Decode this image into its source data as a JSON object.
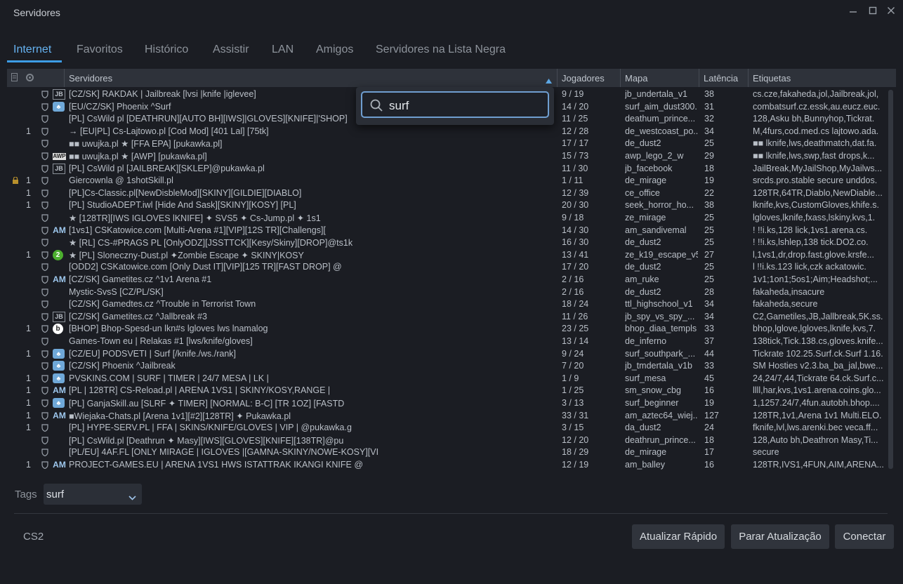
{
  "window": {
    "title": "Servidores"
  },
  "tabs": [
    "Internet",
    "Favoritos",
    "Histórico",
    "Assistir",
    "LAN",
    "Amigos",
    "Servidores na Lista Negra"
  ],
  "columns": {
    "servers": "Servidores",
    "players": "Jogadores",
    "map": "Mapa",
    "latency": "Latência",
    "tags": "Etiquetas"
  },
  "search": {
    "value": "surf"
  },
  "rows": [
    {
      "lock": false,
      "bots": "",
      "icon": "JB",
      "name": "[CZ/SK] RAKDAK | Jailbreak [lvsi |knife |iglevee]",
      "players": "9 / 19",
      "map": "jb_undertala_v1",
      "latency": "38",
      "tags": "cs.cze,fakaheda,jol,Jailbreak,jol,"
    },
    {
      "lock": false,
      "bots": "",
      "icon": "ph",
      "name": "[EU/CZ/SK] Phoenix ^Surf",
      "players": "14 / 20",
      "map": "surf_aim_dust300...",
      "latency": "31",
      "tags": "combatsurf.cz.essk,au.eucz.euc."
    },
    {
      "lock": false,
      "bots": "",
      "icon": "",
      "name": "[PL] CsWild pl [DEATHRUN][AUTO BH][IWS]|GLOVES][KNIFE]|'SHOP]",
      "players": "11 / 25",
      "map": "deathum_prince...",
      "latency": "32",
      "tags": "128,Asku bh,Bunnyhop,Tickrat."
    },
    {
      "lock": false,
      "bots": "1",
      "icon": "",
      "name": "→ [EU|PL] Cs-Lajtowo.pl [Cod Mod] [401 Lal] [75tk]",
      "players": "12 / 28",
      "map": "de_westcoast_po...",
      "latency": "34",
      "tags": "M,4furs,cod.med.cs lajtowo.ada."
    },
    {
      "lock": false,
      "bots": "",
      "icon": "",
      "name": "■■ uwujka.pl ★ [FFA EPA] [pukawka.pl]",
      "players": "17 / 17",
      "map": "de_dust2",
      "latency": "25",
      "tags": "■■ lknife,lws,deathmatch,dat.fa."
    },
    {
      "lock": false,
      "bots": "",
      "icon": "AW",
      "name": "■■ uwujka.pl ★ [AWP] [pukawka.pl]",
      "players": "15 / 73",
      "map": "awp_lego_2_w",
      "latency": "29",
      "tags": "■■ lknife,lws,swp,fast drops,k..."
    },
    {
      "lock": false,
      "bots": "",
      "icon": "JB",
      "name": "[PL] CsWild pl [JAILBREAK][SKLEP]@pukawka.pl",
      "players": "11 / 30",
      "map": "jb_facebook",
      "latency": "18",
      "tags": "JailBreak,MyJailShop,MyJailws..."
    },
    {
      "lock": true,
      "bots": "1",
      "icon": "",
      "name": "Giercownla @ 1shotSkill.pl",
      "players": "1 / 11",
      "map": "de_mirage",
      "latency": "19",
      "tags": "srcds.pro.stable secure unddos."
    },
    {
      "lock": false,
      "bots": "1",
      "icon": "",
      "name": "[PL]Cs-Classic.pl[NewDisbleMod][SKINY][GILDIE][DIABLO]",
      "players": "12 / 39",
      "map": "ce_office",
      "latency": "22",
      "tags": "128TR,64TR,Diablo,NewDiable..."
    },
    {
      "lock": false,
      "bots": "1",
      "icon": "",
      "name": "[PL] StudioADEPT.iwl [Hide And Sask][SKINY][KOSY] [PL]",
      "players": "20 / 30",
      "map": "seek_horror_ho...",
      "latency": "38",
      "tags": "lknife,kvs,CustomGloves,khife.s."
    },
    {
      "lock": false,
      "bots": "",
      "icon": "",
      "name": "★ [128TR][IWS IGLOVES lKNIFE] ✦ SVS5 ✦ Cs-Jump.pl ✦ 1s1",
      "players": "9 / 18",
      "map": "ze_mirage",
      "latency": "25",
      "tags": "lgloves,lknife,fxass,lskiny,kvs,1."
    },
    {
      "lock": false,
      "bots": "",
      "icon": "AM",
      "name": "[1vs1] CSKatowice.com [Multi-Arena #1][VIP][12S TR][Challengs][",
      "players": "14 / 30",
      "map": "am_sandivemal",
      "latency": "25",
      "tags": "!     !!i.ks,128 lick,1vs1.arena.cs."
    },
    {
      "lock": false,
      "bots": "",
      "icon": "",
      "name": "★ [RL] CS-#PRAGS PL [OnlyODZ][JSSTTCK][Kesy/Skiny][DROP]@ts1k",
      "players": "16 / 30",
      "map": "de_dust2",
      "latency": "25",
      "tags": "!     !!i.ks,lshlep,138 tick.DO2.co."
    },
    {
      "lock": false,
      "bots": "1",
      "icon": "2",
      "name": "★ [PL] Sloneczny-Dust.pl  ✦Zombie Escape ✦ SKINY|KOSY",
      "players": "13 / 41",
      "map": "ze_k19_escape_v5",
      "latency": "27",
      "tags": "l,1vs1,dr,drop.fast.glove.krsfe..."
    },
    {
      "lock": false,
      "bots": "",
      "icon": "",
      "name": "[ODD2] CSKatowice.com [Only Dust IT][VIP][125 TR][FAST DROP] @",
      "players": "17 / 20",
      "map": "de_dust2",
      "latency": "25",
      "tags": "l     !!i.ks.123 lick,czk ackatowic."
    },
    {
      "lock": false,
      "bots": "",
      "icon": "AM",
      "name": "[CZ/SK] Gametites.cz ^1v1 Arena #1",
      "players": "2 / 16",
      "map": "am_ruke",
      "latency": "25",
      "tags": "1v1;1on1;5os1;Aim;Headshot;..."
    },
    {
      "lock": false,
      "bots": "",
      "icon": "",
      "name": "Mystic-SvsS [CZ/PL/SK]",
      "players": "2 / 16",
      "map": "de_dust2",
      "latency": "28",
      "tags": "fakaheda,insacure"
    },
    {
      "lock": false,
      "bots": "",
      "icon": "",
      "name": "[CZ/SK] Gamedtes.cz ^Trouble in Terrorist Town",
      "players": "18 / 24",
      "map": "ttl_highschool_v1",
      "latency": "34",
      "tags": "fakaheda,secure"
    },
    {
      "lock": false,
      "bots": "",
      "icon": "JB",
      "name": "[CZ/SK] Gametites.cz ^Jallbreak #3",
      "players": "11 / 26",
      "map": "jb_spy_vs_spy_...",
      "latency": "34",
      "tags": "C2,Gametiles,JB,Jallbreak,5K.ss."
    },
    {
      "lock": false,
      "bots": "1",
      "icon": "b",
      "name": "[BHOP] Bhop-Spesd-un lkn#s lgloves lws lnamalog",
      "players": "23 / 25",
      "map": "bhop_diaa_templs",
      "latency": "33",
      "tags": "bhop,lglove,lgloves,lknife,kvs,7."
    },
    {
      "lock": false,
      "bots": "",
      "icon": "",
      "name": "Games-Town eu | Relakas #1 [lws/knife/gloves]",
      "players": "13 / 14",
      "map": "de_inferno",
      "latency": "37",
      "tags": "138tick,Tick.138.cs,gloves.knife..."
    },
    {
      "lock": false,
      "bots": "1",
      "icon": "ph",
      "name": "[CZ/EU] PODSVETI | Surf [/knife./ws./rank]",
      "players": "9 / 24",
      "map": "surf_southpark_...",
      "latency": "44",
      "tags": "Tickrate 102.25.Surf.ck.Surf 1.16."
    },
    {
      "lock": false,
      "bots": "",
      "icon": "ph",
      "name": "[CZ/SK] Phoenix ^Jailbreak",
      "players": "7 / 20",
      "map": "jb_tmdertala_v1b",
      "latency": "33",
      "tags": "SM Hosties v2.3.ba_ba_jal,bwe..."
    },
    {
      "lock": false,
      "bots": "1",
      "icon": "ph",
      "name": "PVSKINS.COM | SURF | TIMER | 24/7 MESA | LK |",
      "players": "1 / 9",
      "map": "surf_mesa",
      "latency": "45",
      "tags": "24,24/7,44,Tickrate 64.ck.Surf.c..."
    },
    {
      "lock": false,
      "bots": "1",
      "icon": "AM",
      "name": "[PL | 128TR] CS-Reload.pl | ARENA 1VS1 | SKINY/KOSY,RANGE |",
      "players": "1 / 25",
      "map": "sm_snow_cbg",
      "latency": "16",
      "tags": "llll,har,kvs,1vs1.arena.coins.glo..."
    },
    {
      "lock": false,
      "bots": "1",
      "icon": "ph",
      "name": "[PL] GanjaSkill.au [SLRF ✦ TIMER] [NORMAL: B-C] [TR 1OZ] [FASTD",
      "players": "3 / 13",
      "map": "surf_beginner",
      "latency": "19",
      "tags": "1,1257.24/7,4fun.autobh.bhop...."
    },
    {
      "lock": false,
      "bots": "1",
      "icon": "AM",
      "name": "■Wiejaka-Chats.pl [Arena 1v1][#2][128TR] ✦ Pukawka.pl",
      "players": "33 / 31",
      "map": "am_aztec64_wiej...",
      "latency": "127",
      "tags": "128TR,1v1,Arena 1v1 Multi.ELO."
    },
    {
      "lock": false,
      "bots": "1",
      "icon": "",
      "name": "[PL] HYPE-SERV.PL | FFA | SKINS/KNIFE/GLOVES | VIP | @pukawka.g",
      "players": "3 / 15",
      "map": "da_dust2",
      "latency": "24",
      "tags": "fknife,lvl,lws.arenki.bec veca.ff..."
    },
    {
      "lock": false,
      "bots": "",
      "icon": "",
      "name": "[PL] CsWild.pl [Deathrun ✦ Masy][IWS][GLOVES][KNIFE][138TR]@pu",
      "players": "12 / 20",
      "map": "deathrun_prince...",
      "latency": "18",
      "tags": "128,Auto bh,Deathron Masy,Ti..."
    },
    {
      "lock": false,
      "bots": "",
      "icon": "",
      "name": "[PL/EU] 4AF.FL [ONLY MIRAGE | IGLOVES |[GAMNA-SKINY/NOWE-KOSY][VI",
      "players": "18 / 29",
      "map": "de_mirage",
      "latency": "17",
      "tags": "secure"
    },
    {
      "lock": false,
      "bots": "1",
      "icon": "AM",
      "name": "PROJECT-GAMES.EU | ARENA 1VS1 HWS ISTATTRAK IKANGI KNIFE @",
      "players": "12 / 19",
      "map": "am_balley",
      "latency": "16",
      "tags": "128TR,IVS1,4FUN,AIM,ARENA..."
    }
  ],
  "filter": {
    "label": "Tags",
    "value": "surf"
  },
  "footer": {
    "app": "CS2",
    "btn_quick": "Atualizar Rápido",
    "btn_stop": "Parar Atualização",
    "btn_connect": "Conectar"
  }
}
